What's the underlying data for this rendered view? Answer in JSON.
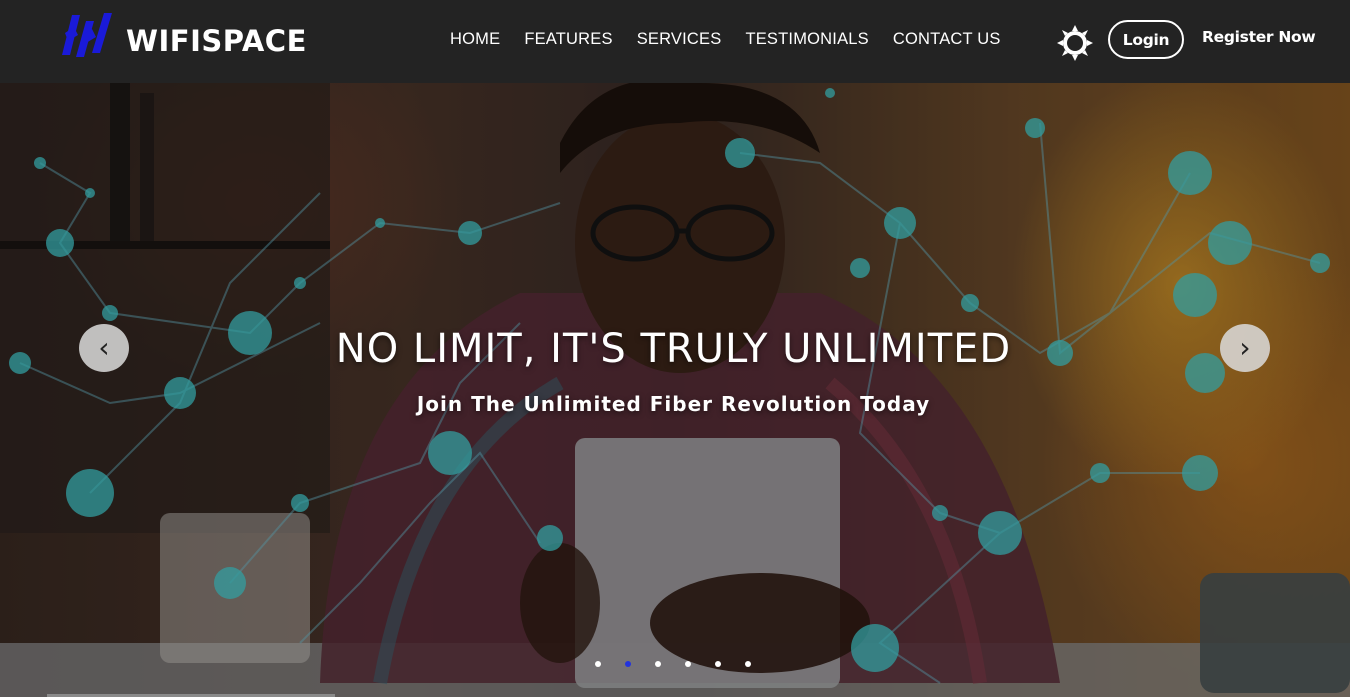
{
  "brand": {
    "name": "WIFISPACE",
    "logo_icon": "wifispace-logo-icon",
    "logo_color": "#1a1ad8"
  },
  "nav": {
    "links": [
      {
        "label": "HOME"
      },
      {
        "label": "FEATURES"
      },
      {
        "label": "SERVICES"
      },
      {
        "label": "TESTIMONIALS"
      },
      {
        "label": "CONTACT US"
      }
    ],
    "theme_icon": "sun-icon",
    "login_label": "Login",
    "register_label": "Register Now"
  },
  "hero": {
    "title": "NO LIMIT, IT'S TRULY UNLIMITED",
    "subtitle": "Join The Unlimited Fiber Revolution Today",
    "prev_label": "‹",
    "next_label": "›",
    "slide_count": 6,
    "active_slide": 2,
    "active_color": "#2233dd"
  }
}
